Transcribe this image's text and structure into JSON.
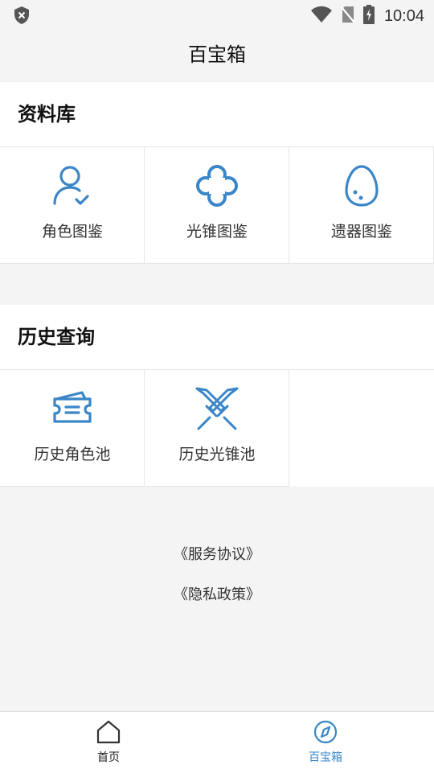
{
  "status_bar": {
    "time": "10:04"
  },
  "header": {
    "title": "百宝箱"
  },
  "library": {
    "title": "资料库",
    "items": [
      {
        "label": "角色图鉴",
        "icon": "character-user-icon"
      },
      {
        "label": "光锥图鉴",
        "icon": "clover-icon"
      },
      {
        "label": "遗器图鉴",
        "icon": "egg-icon"
      }
    ]
  },
  "history": {
    "title": "历史查询",
    "items": [
      {
        "label": "历史角色池",
        "icon": "ticket-icon"
      },
      {
        "label": "历史光锥池",
        "icon": "crossed-swords-icon"
      }
    ]
  },
  "links": {
    "service": "《服务协议》",
    "privacy": "《隐私政策》"
  },
  "bottom_nav": {
    "home": "首页",
    "toolbox": "百宝箱"
  },
  "colors": {
    "accent": "#3a86c8",
    "background": "#f4f4f4"
  }
}
